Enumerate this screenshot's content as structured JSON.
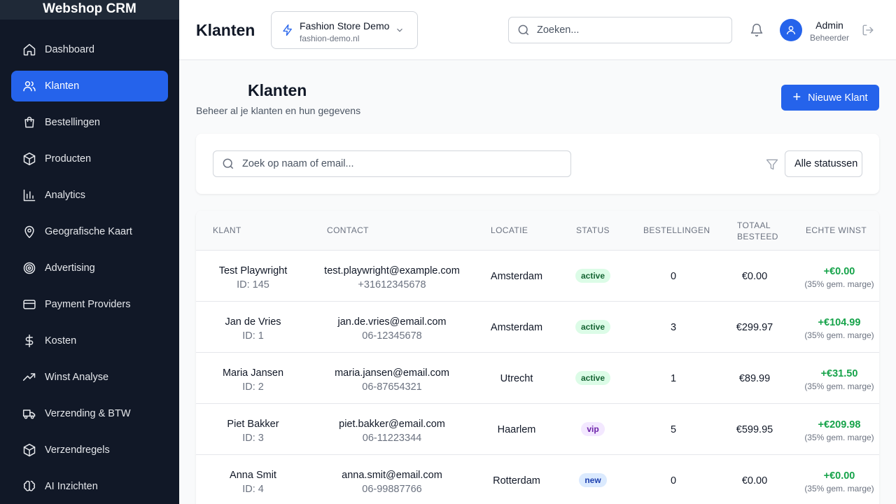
{
  "app": {
    "brand": "Webshop CRM"
  },
  "sidebar": {
    "items": [
      {
        "label": "Dashboard",
        "icon": "home-icon",
        "active": false
      },
      {
        "label": "Klanten",
        "icon": "users-icon",
        "active": true
      },
      {
        "label": "Bestellingen",
        "icon": "shopping-bag-icon",
        "active": false
      },
      {
        "label": "Producten",
        "icon": "package-icon",
        "active": false
      },
      {
        "label": "Analytics",
        "icon": "bar-chart-icon",
        "active": false
      },
      {
        "label": "Geografische Kaart",
        "icon": "map-pin-icon",
        "active": false
      },
      {
        "label": "Advertising",
        "icon": "target-icon",
        "active": false
      },
      {
        "label": "Payment Providers",
        "icon": "credit-card-icon",
        "active": false
      },
      {
        "label": "Kosten",
        "icon": "dollar-icon",
        "active": false
      },
      {
        "label": "Winst Analyse",
        "icon": "trending-up-icon",
        "active": false
      },
      {
        "label": "Verzending & BTW",
        "icon": "truck-icon",
        "active": false
      },
      {
        "label": "Verzendregels",
        "icon": "box-icon",
        "active": false
      },
      {
        "label": "AI Inzichten",
        "icon": "brain-icon",
        "active": false
      }
    ]
  },
  "header": {
    "title": "Klanten",
    "store": {
      "name": "Fashion Store Demo",
      "domain": "fashion-demo.nl"
    },
    "search_placeholder": "Zoeken...",
    "user": {
      "name": "Admin",
      "role": "Beheerder"
    }
  },
  "page": {
    "title": "Klanten",
    "subtitle": "Beheer al je klanten en hun gegevens",
    "new_button": "Nieuwe Klant",
    "filter_search_placeholder": "Zoek op naam of email...",
    "status_filter": "Alle statussen"
  },
  "table": {
    "headers": {
      "klant": "Klant",
      "contact": "Contact",
      "locatie": "Locatie",
      "status": "Status",
      "bestellingen": "Bestellingen",
      "totaal_line1": "Totaal",
      "totaal_line2": "Besteed",
      "winst": "Echte Winst"
    },
    "rows": [
      {
        "name": "Test Playwright",
        "id": "ID: 145",
        "email": "test.playwright@example.com",
        "phone": "+31612345678",
        "location": "Amsterdam",
        "status": "active",
        "orders": "0",
        "spent": "€0.00",
        "profit": "+€0.00",
        "margin": "(35% gem. marge)"
      },
      {
        "name": "Jan de Vries",
        "id": "ID: 1",
        "email": "jan.de.vries@email.com",
        "phone": "06-12345678",
        "location": "Amsterdam",
        "status": "active",
        "orders": "3",
        "spent": "€299.97",
        "profit": "+€104.99",
        "margin": "(35% gem. marge)"
      },
      {
        "name": "Maria Jansen",
        "id": "ID: 2",
        "email": "maria.jansen@email.com",
        "phone": "06-87654321",
        "location": "Utrecht",
        "status": "active",
        "orders": "1",
        "spent": "€89.99",
        "profit": "+€31.50",
        "margin": "(35% gem. marge)"
      },
      {
        "name": "Piet Bakker",
        "id": "ID: 3",
        "email": "piet.bakker@email.com",
        "phone": "06-11223344",
        "location": "Haarlem",
        "status": "vip",
        "orders": "5",
        "spent": "€599.95",
        "profit": "+€209.98",
        "margin": "(35% gem. marge)"
      },
      {
        "name": "Anna Smit",
        "id": "ID: 4",
        "email": "anna.smit@email.com",
        "phone": "06-99887766",
        "location": "Rotterdam",
        "status": "new",
        "orders": "0",
        "spent": "€0.00",
        "profit": "+€0.00",
        "margin": "(35% gem. marge)"
      }
    ]
  },
  "colors": {
    "sidebar_bg": "#111827",
    "accent": "#2563eb",
    "profit": "#16a34a"
  }
}
